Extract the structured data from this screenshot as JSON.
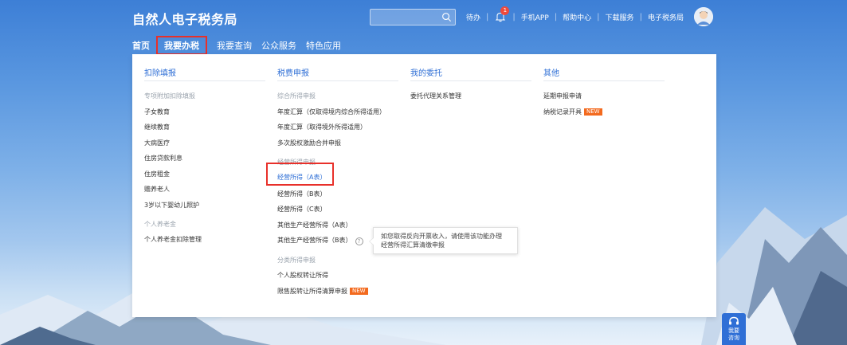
{
  "header": {
    "brand": "自然人电子税务局",
    "search_placeholder": "",
    "links": {
      "todo": "待办",
      "bell_count": "1",
      "mobile_app": "手机APP",
      "help_center": "帮助中心",
      "download": "下载服务",
      "e_tax": "电子税务局"
    }
  },
  "nav": {
    "home": "首页",
    "handle_tax": "我要办税",
    "query": "我要查询",
    "public_service": "公众服务",
    "special_apps": "特色应用"
  },
  "menu": {
    "columns": [
      {
        "title": "扣除填报",
        "entries": [
          {
            "label": "专项附加扣除填报",
            "type": "group"
          },
          {
            "label": "子女教育",
            "type": "link"
          },
          {
            "label": "继续教育",
            "type": "link"
          },
          {
            "label": "大病医疗",
            "type": "link"
          },
          {
            "label": "住房贷款利息",
            "type": "link"
          },
          {
            "label": "住房租金",
            "type": "link"
          },
          {
            "label": "赡养老人",
            "type": "link"
          },
          {
            "label": "3岁以下婴幼儿照护",
            "type": "link"
          },
          {
            "label": "个人养老金",
            "type": "group"
          },
          {
            "label": "个人养老金扣除管理",
            "type": "link"
          }
        ]
      },
      {
        "title": "税费申报",
        "entries": [
          {
            "label": "综合所得申报",
            "type": "group"
          },
          {
            "label": "年度汇算（仅取得境内综合所得适用）",
            "type": "link"
          },
          {
            "label": "年度汇算（取得境外所得适用）",
            "type": "link"
          },
          {
            "label": "多次股权激励合并申报",
            "type": "link"
          },
          {
            "label": "经营所得申报",
            "type": "group"
          },
          {
            "label": "经营所得（A表）",
            "type": "link"
          },
          {
            "label": "经营所得（B表）",
            "type": "link"
          },
          {
            "label": "经营所得（C表）",
            "type": "link"
          },
          {
            "label": "其他生产经营所得（A表）",
            "type": "link"
          },
          {
            "label": "其他生产经营所得（B表）",
            "type": "link"
          },
          {
            "label": "分类所得申报",
            "type": "group"
          },
          {
            "label": "个人股权转让所得",
            "type": "link"
          },
          {
            "label": "限售股转让所得清算申报",
            "type": "link",
            "badge": "NEW"
          }
        ]
      },
      {
        "title": "我的委托",
        "entries": [
          {
            "label": "委托代理关系管理",
            "type": "link"
          }
        ]
      },
      {
        "title": "其他",
        "entries": [
          {
            "label": "延期申报申请",
            "type": "link"
          },
          {
            "label": "纳税记录开具",
            "type": "link",
            "badge": "NEW"
          }
        ]
      }
    ],
    "tooltip": "如您取得反向开票收入，请使用该功能办理\n经营所得汇算清缴申报"
  },
  "float_button": {
    "line1": "我要",
    "line2": "咨询"
  },
  "colors": {
    "brand_blue": "#2f6fd6",
    "highlight_red": "#e8302a",
    "badge_orange": "#f36a1e"
  }
}
